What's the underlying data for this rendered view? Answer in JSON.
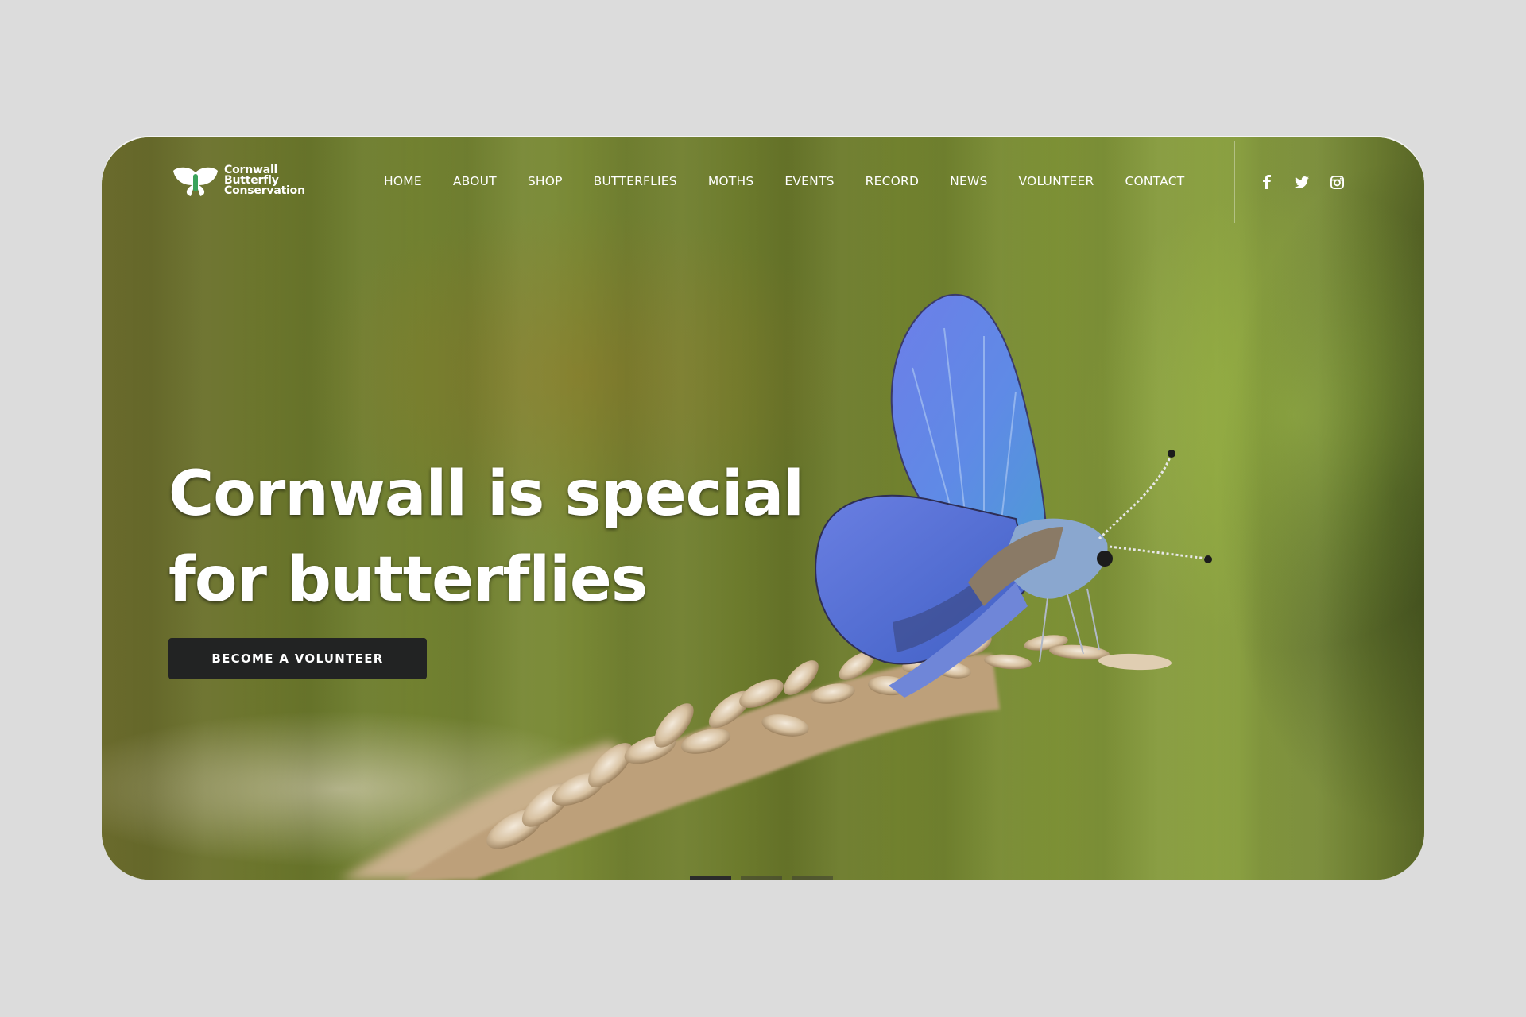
{
  "site": {
    "logo_lines": [
      "Cornwall",
      "Butterfly",
      "Conservation"
    ]
  },
  "nav": {
    "items": [
      {
        "label": "HOME"
      },
      {
        "label": "ABOUT"
      },
      {
        "label": "SHOP"
      },
      {
        "label": "BUTTERFLIES"
      },
      {
        "label": "MOTHS"
      },
      {
        "label": "EVENTS"
      },
      {
        "label": "RECORD"
      },
      {
        "label": "NEWS"
      },
      {
        "label": "VOLUNTEER"
      },
      {
        "label": "CONTACT"
      }
    ],
    "social": [
      "facebook-icon",
      "twitter-icon",
      "instagram-icon"
    ]
  },
  "hero": {
    "title_line1": "Cornwall is special",
    "title_line2": "for butterflies",
    "cta_label": "BECOME A VOLUNTEER",
    "slides": 3,
    "active_slide": 1
  },
  "colors": {
    "page_bg": "#dcdcdc",
    "cta_bg": "#222323",
    "logo_accent": "#3aa35b",
    "butterfly_blue": "#5a7fe0"
  }
}
